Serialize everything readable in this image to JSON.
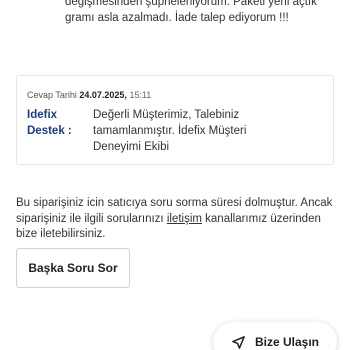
{
  "customer_message": {
    "line1": "değişmesinden şüpheleniyorum. Paketi yeni açtık",
    "line2": "gramı asla azalmadı. İade talep ediyorum !!!"
  },
  "seller_reply": {
    "date_label": "Cevap Tarihi",
    "date_value": "24.07.2025,",
    "time_value": "15:11",
    "author_line1": "Idefix",
    "author_line2": "Destek :",
    "text_line1": "Değerli Müşterimiz, Talebiniz",
    "text_line2": "tamamlanmıştır. İdefix Müşteri",
    "text_line3": "Deneyimi Ekibi"
  },
  "notice": {
    "text_before": "Bu siparişiniz icin satıcıya soru sorma süresi dolmuştur. Ancak siparişiniz ile ilgili sorularınızı ",
    "link": "iletişim",
    "text_after": " kanallarımız üzerinden bize iletebilirsiniz."
  },
  "ask_button_label": "Başka Soru Sor",
  "contact_button": {
    "label": "Bize Ulaşın",
    "icon": "send-arrow-icon"
  }
}
